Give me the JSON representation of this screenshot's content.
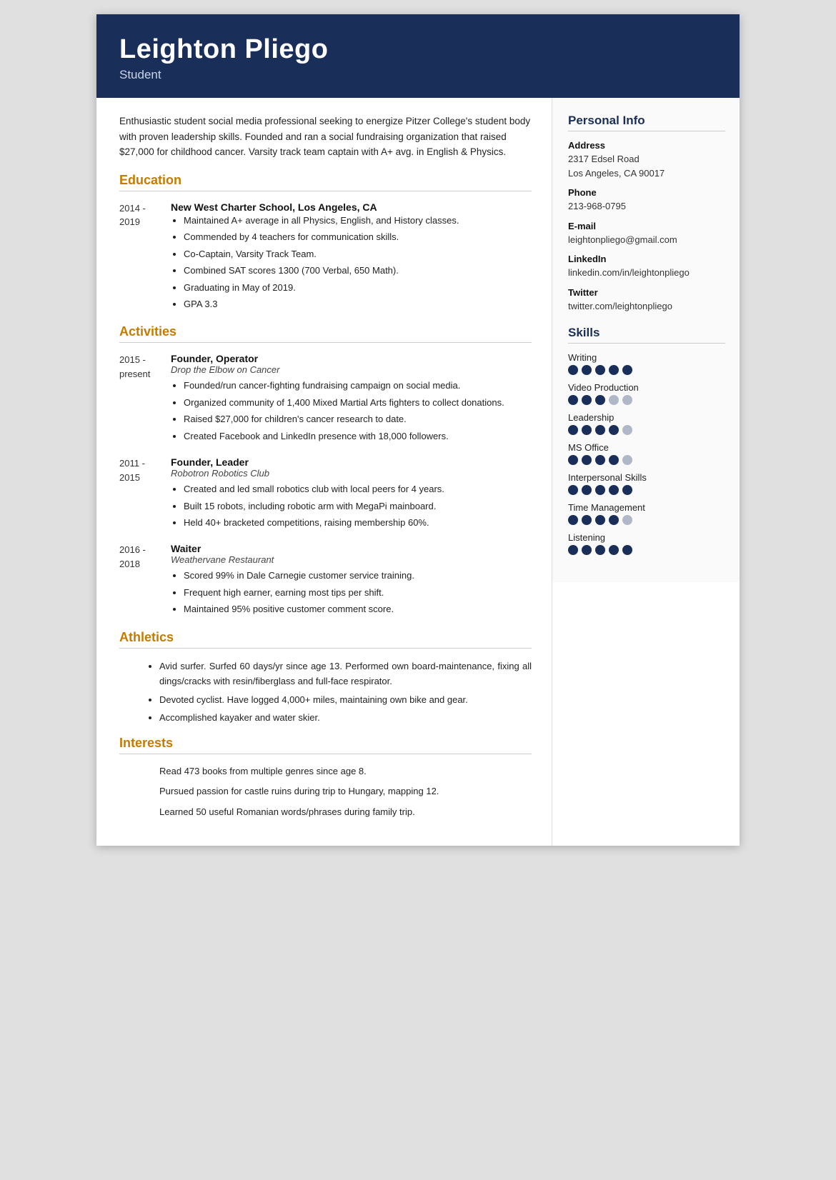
{
  "header": {
    "name": "Leighton Pliego",
    "title": "Student"
  },
  "summary": "Enthusiastic student social media professional seeking to energize Pitzer College's student body with proven leadership skills. Founded and ran a social fundraising organization that raised $27,000 for childhood cancer. Varsity track team captain with A+ avg. in English & Physics.",
  "sections": {
    "education": {
      "label": "Education",
      "entries": [
        {
          "date_start": "2014 -",
          "date_end": "2019",
          "title": "New West Charter School, Los Angeles, CA",
          "subtitle": "",
          "bullets": [
            "Maintained A+ average in all Physics, English, and History classes.",
            "Commended by 4 teachers for communication skills.",
            "Co-Captain, Varsity Track Team.",
            "Combined SAT scores 1300 (700 Verbal, 650 Math).",
            "Graduating in May of 2019.",
            "GPA 3.3"
          ]
        }
      ]
    },
    "activities": {
      "label": "Activities",
      "entries": [
        {
          "date_start": "2015 -",
          "date_end": "present",
          "title": "Founder, Operator",
          "subtitle": "Drop the Elbow on Cancer",
          "bullets": [
            "Founded/run cancer-fighting fundraising campaign on social media.",
            "Organized community of 1,400 Mixed Martial Arts fighters to collect donations.",
            "Raised $27,000 for children's cancer research to date.",
            "Created Facebook and LinkedIn presence with 18,000 followers."
          ]
        },
        {
          "date_start": "2011 -",
          "date_end": "2015",
          "title": "Founder, Leader",
          "subtitle": "Robotron Robotics Club",
          "bullets": [
            "Created and led small robotics club with local peers for 4 years.",
            "Built 15 robots, including robotic arm with MegaPi mainboard.",
            "Held 40+ bracketed competitions, raising membership 60%."
          ]
        },
        {
          "date_start": "2016 -",
          "date_end": "2018",
          "title": "Waiter",
          "subtitle": "Weathervane Restaurant",
          "bullets": [
            "Scored 99% in Dale Carnegie customer service training.",
            "Frequent high earner, earning most tips per shift.",
            "Maintained 95% positive customer comment score."
          ]
        }
      ]
    },
    "athletics": {
      "label": "Athletics",
      "bullets": [
        "Avid surfer. Surfed 60 days/yr since age 13. Performed own board-maintenance, fixing all dings/cracks with resin/fiberglass and full-face respirator.",
        "Devoted cyclist. Have logged 4,000+ miles, maintaining own bike and gear.",
        "Accomplished kayaker and water skier."
      ]
    },
    "interests": {
      "label": "Interests",
      "paragraphs": [
        "Read 473 books from multiple genres since age 8.",
        "Pursued passion for castle ruins during trip to Hungary, mapping 12.",
        "Learned 50 useful Romanian words/phrases during family trip."
      ]
    }
  },
  "sidebar": {
    "personal_info": {
      "heading": "Personal Info",
      "address_label": "Address",
      "address_line1": "2317 Edsel Road",
      "address_line2": "Los Angeles, CA 90017",
      "phone_label": "Phone",
      "phone": "213-968-0795",
      "email_label": "E-mail",
      "email": "leightonpliego@gmail.com",
      "linkedin_label": "LinkedIn",
      "linkedin": "linkedin.com/in/leightonpliego",
      "twitter_label": "Twitter",
      "twitter": "twitter.com/leightonpliego"
    },
    "skills": {
      "heading": "Skills",
      "items": [
        {
          "name": "Writing",
          "filled": 5,
          "total": 5
        },
        {
          "name": "Video Production",
          "filled": 3,
          "total": 5
        },
        {
          "name": "Leadership",
          "filled": 4,
          "total": 5
        },
        {
          "name": "MS Office",
          "filled": 4,
          "total": 5
        },
        {
          "name": "Interpersonal Skills",
          "filled": 5,
          "total": 5
        },
        {
          "name": "Time Management",
          "filled": 4,
          "total": 5
        },
        {
          "name": "Listening",
          "filled": 5,
          "total": 5
        }
      ]
    }
  }
}
